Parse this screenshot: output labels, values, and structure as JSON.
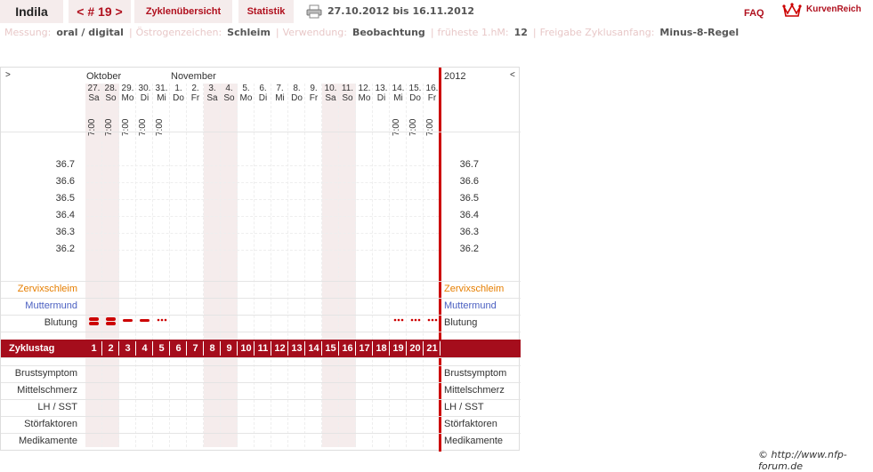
{
  "tabs": {
    "name": "Indila",
    "cycle": "< # 19 >",
    "overview": "Zyklenübersicht",
    "statistics": "Statistik"
  },
  "date_range": "27.10.2012 bis 16.11.2012",
  "faq": "FAQ",
  "brand": "KurvenReich",
  "info": [
    {
      "label": "Messung:",
      "value": "oral / digital"
    },
    {
      "label": "Östrogenzeichen:",
      "value": "Schleim"
    },
    {
      "label": "Verwendung:",
      "value": "Beobachtung"
    },
    {
      "label": "früheste 1.hM:",
      "value": "12"
    },
    {
      "label": "Freigabe Zyklusanfang:",
      "value": "Minus-8-Regel"
    }
  ],
  "chart": {
    "nav_left": ">",
    "nav_right": "<",
    "months": [
      "Oktober",
      "November"
    ],
    "year": "2012",
    "days": [
      {
        "d": "27.",
        "w": "Sa",
        "t": "7:00",
        "we": true
      },
      {
        "d": "28.",
        "w": "So",
        "t": "7:00",
        "we": true
      },
      {
        "d": "29.",
        "w": "Mo",
        "t": "7:00",
        "we": false
      },
      {
        "d": "30.",
        "w": "Di",
        "t": "7:00",
        "we": false
      },
      {
        "d": "31.",
        "w": "Mi",
        "t": "7:00",
        "we": false
      },
      {
        "d": "1.",
        "w": "Do",
        "t": "",
        "we": false
      },
      {
        "d": "2.",
        "w": "Fr",
        "t": "",
        "we": false
      },
      {
        "d": "3.",
        "w": "Sa",
        "t": "",
        "we": true
      },
      {
        "d": "4.",
        "w": "So",
        "t": "",
        "we": true
      },
      {
        "d": "5.",
        "w": "Mo",
        "t": "",
        "we": false
      },
      {
        "d": "6.",
        "w": "Di",
        "t": "",
        "we": false
      },
      {
        "d": "7.",
        "w": "Mi",
        "t": "",
        "we": false
      },
      {
        "d": "8.",
        "w": "Do",
        "t": "",
        "we": false
      },
      {
        "d": "9.",
        "w": "Fr",
        "t": "",
        "we": false
      },
      {
        "d": "10.",
        "w": "Sa",
        "t": "",
        "we": true
      },
      {
        "d": "11.",
        "w": "So",
        "t": "",
        "we": true
      },
      {
        "d": "12.",
        "w": "Mo",
        "t": "",
        "we": false
      },
      {
        "d": "13.",
        "w": "Di",
        "t": "",
        "we": false
      },
      {
        "d": "14.",
        "w": "Mi",
        "t": "7:00",
        "we": false
      },
      {
        "d": "15.",
        "w": "Do",
        "t": "7:00",
        "we": false
      },
      {
        "d": "16.",
        "w": "Fr",
        "t": "7:00",
        "we": false
      }
    ],
    "temps": [
      "36.7",
      "36.6",
      "36.5",
      "36.4",
      "36.3",
      "36.2"
    ],
    "rows_top": [
      {
        "label": "Zervixschleim",
        "color": "#e67e00"
      },
      {
        "label": "Muttermund",
        "color": "#4a5fc1"
      },
      {
        "label": "Blutung",
        "color": "#333333"
      }
    ],
    "bleeding": [
      "heavy",
      "heavy",
      "medium",
      "medium",
      "light",
      "",
      "",
      "",
      "",
      "",
      "",
      "",
      "",
      "",
      "",
      "",
      "",
      "",
      "light",
      "light",
      "light"
    ],
    "cycle_label": "Zyklustag",
    "cycle_days": [
      "1",
      "2",
      "3",
      "4",
      "5",
      "6",
      "7",
      "8",
      "9",
      "10",
      "11",
      "12",
      "13",
      "14",
      "15",
      "16",
      "17",
      "18",
      "19",
      "20",
      "21"
    ],
    "rows_bottom": [
      "Brustsymptom",
      "Mittelschmerz",
      "LH / SST",
      "Störfaktoren",
      "Medikamente"
    ]
  },
  "copyright": "© http://www.nfp-forum.de",
  "colors": {
    "accent": "#b0101e",
    "band": "#a50d1c",
    "weekend": "#f5ecec"
  }
}
